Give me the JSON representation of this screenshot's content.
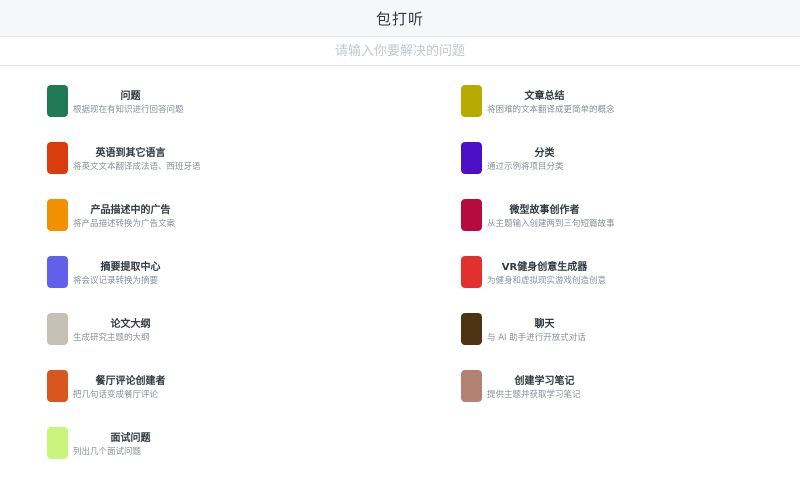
{
  "header": {
    "title": "包打听"
  },
  "search": {
    "placeholder": "请输入你要解决的问题",
    "value": ""
  },
  "items": [
    {
      "name": "问题",
      "desc": "根据现在有知识进行回答问题",
      "color": "#1f7a55"
    },
    {
      "name": "文章总结",
      "desc": "将困难的文本翻译成更简单的概念",
      "color": "#b8ab00"
    },
    {
      "name": "英语到其它语言",
      "desc": "将英文文本翻译成法语、西班牙语",
      "color": "#d93c0d"
    },
    {
      "name": "分类",
      "desc": "通过示例将项目分类",
      "color": "#4b0fc6"
    },
    {
      "name": "产品描述中的广告",
      "desc": "将产品描述转换为广告文案",
      "color": "#f29100"
    },
    {
      "name": "微型故事创作者",
      "desc": "从主题输入创建两到三句短篇故事",
      "color": "#b80b3d"
    },
    {
      "name": "摘要提取中心",
      "desc": "将会议记录转换为摘要",
      "color": "#6060ea"
    },
    {
      "name": "VR健身创意生成器",
      "desc": "为健身和虚拟现实游戏创造创意",
      "color": "#e22f2f"
    },
    {
      "name": "论文大纲",
      "desc": "生成研究主题的大纲",
      "color": "#c6bfb4"
    },
    {
      "name": "聊天",
      "desc": "与 AI 助手进行开放式对话",
      "color": "#4f3414"
    },
    {
      "name": "餐厅评论创建者",
      "desc": "把几句话变成餐厅评论",
      "color": "#d9561e"
    },
    {
      "name": "创建学习笔记",
      "desc": "提供主题并获取学习笔记",
      "color": "#b48272"
    },
    {
      "name": "面试问题",
      "desc": "列出几个面试问题",
      "color": "#c9f57b"
    }
  ]
}
